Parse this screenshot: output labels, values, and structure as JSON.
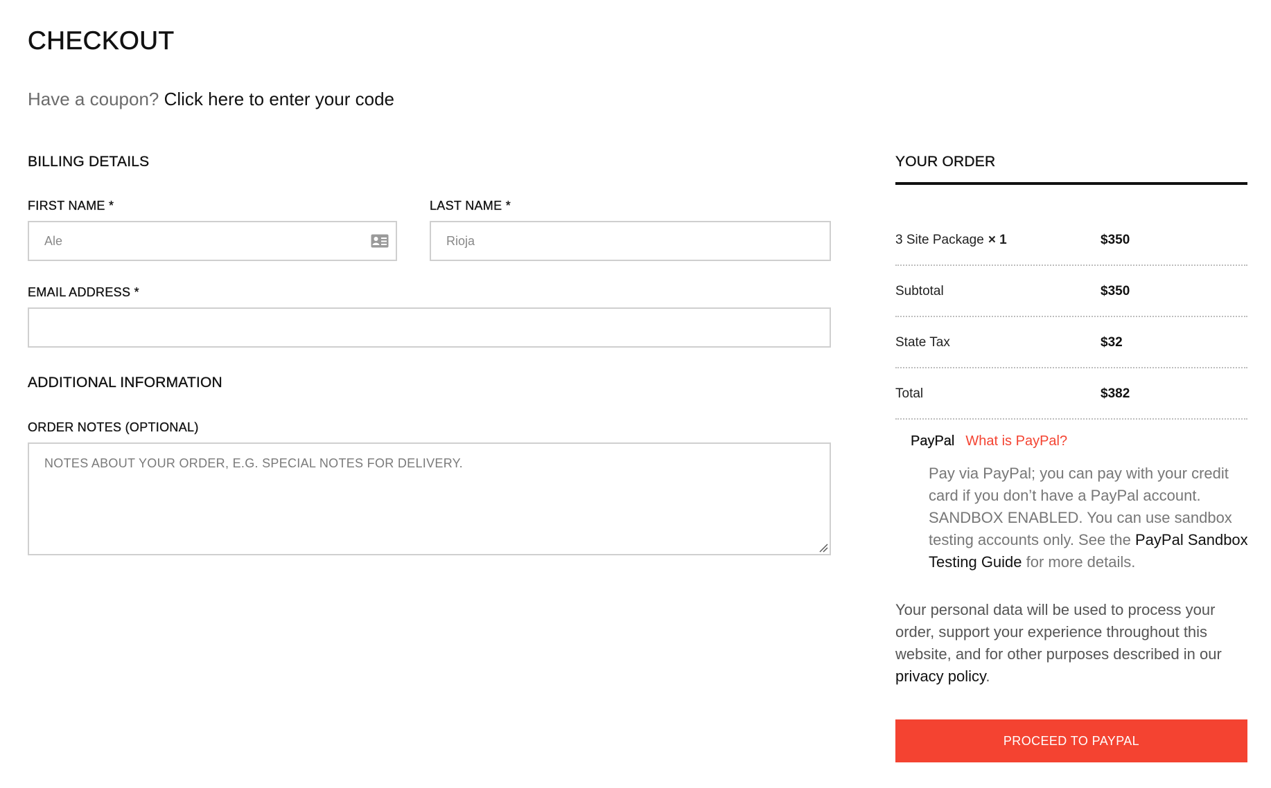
{
  "page": {
    "title": "CHECKOUT"
  },
  "coupon": {
    "prompt": "Have a coupon? ",
    "link": "Click here to enter your code"
  },
  "billing": {
    "heading": "BILLING DETAILS",
    "first_name": {
      "label": "FIRST NAME *",
      "placeholder": "Ale"
    },
    "last_name": {
      "label": "LAST NAME *",
      "placeholder": "Rioja"
    },
    "email": {
      "label": "EMAIL ADDRESS *",
      "value": ""
    }
  },
  "additional": {
    "heading": "ADDITIONAL INFORMATION",
    "notes": {
      "label": "ORDER NOTES (OPTIONAL)",
      "placeholder": "NOTES ABOUT YOUR ORDER, E.G. SPECIAL NOTES FOR DELIVERY."
    }
  },
  "order": {
    "heading": "YOUR ORDER",
    "item": {
      "name": "3 Site Package",
      "qty": "× 1",
      "price": "$350"
    },
    "subtotal": {
      "label": "Subtotal",
      "value": "$350"
    },
    "tax": {
      "label": "State Tax",
      "value": "$32"
    },
    "total": {
      "label": "Total",
      "value": "$382"
    }
  },
  "payment": {
    "method": "PayPal",
    "what_link": "What is PayPal?",
    "desc_before": "Pay via PayPal; you can pay with your credit card if you don’t have a PayPal account. SANDBOX ENABLED. You can use sandbox testing accounts only. See the ",
    "desc_link": "PayPal Sandbox Testing Guide",
    "desc_after": " for more details."
  },
  "privacy": {
    "text": "Your personal data will be used to process your order, support your experience throughout this website, and for other purposes described in our ",
    "link": "privacy policy",
    "end": "."
  },
  "actions": {
    "proceed": "PROCEED TO PAYPAL"
  },
  "colors": {
    "accent": "#f44331",
    "border": "#cfcfcf",
    "text": "#111111"
  }
}
